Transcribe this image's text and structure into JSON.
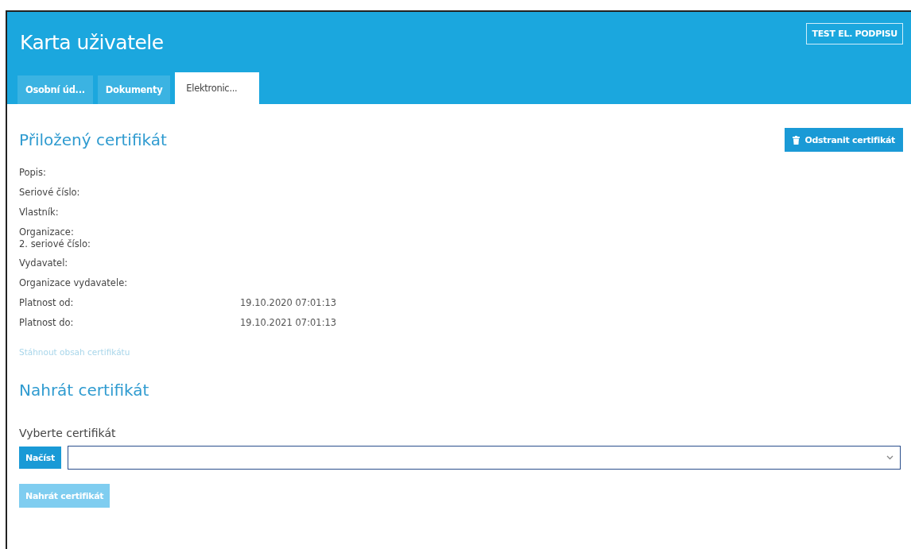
{
  "header": {
    "title": "Karta uživatele",
    "action_button": "TEST EL. PODPISU"
  },
  "tabs": [
    {
      "label": "Osobní úd...",
      "selected": false
    },
    {
      "label": "Dokumenty",
      "selected": false
    },
    {
      "label": "Elektronic...",
      "selected": true
    }
  ],
  "attached_certificate": {
    "heading": "Přiložený certifikát",
    "remove_button": "Odstranit certifikát",
    "fields": [
      {
        "labels": [
          "Popis:"
        ]
      },
      {
        "labels": [
          "Seriové číslo:"
        ]
      },
      {
        "labels": [
          "Vlastník:"
        ]
      },
      {
        "labels": [
          "Organizace:",
          "2. seriové číslo:"
        ]
      },
      {
        "labels": [
          "Vydavatel:"
        ]
      },
      {
        "labels": [
          "Organizace vydavatele:"
        ]
      },
      {
        "labels": [
          "Platnost od:"
        ],
        "value": "19.10.2020 07:01:13"
      },
      {
        "labels": [
          "Platnost do:"
        ],
        "value": "19.10.2021 07:01:13"
      }
    ],
    "download_link": {
      "label": "Stáhnout obsah certifikátu",
      "disabled": true
    }
  },
  "upload": {
    "heading": "Nahrát certifikát",
    "select_label": "Vyberte certifikát",
    "load_button": "Načíst",
    "upload_button": {
      "label": "Nahrát certifikát",
      "disabled": true
    }
  }
}
